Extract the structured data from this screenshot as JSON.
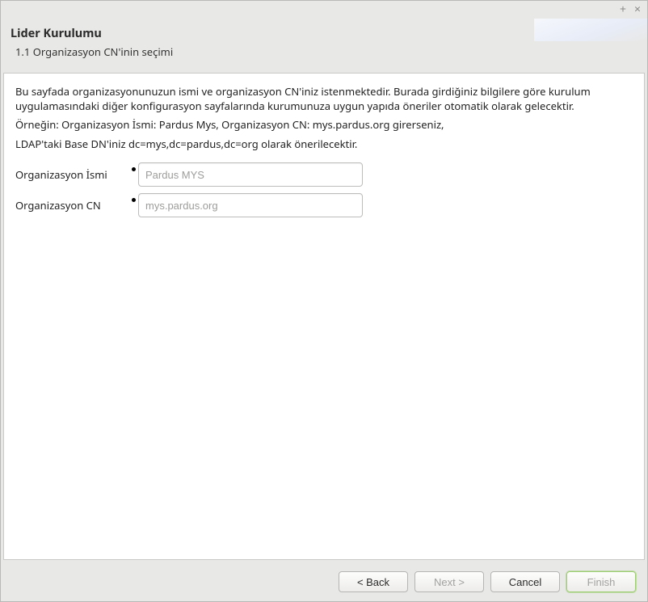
{
  "titlebar": {
    "add_icon": "+",
    "close_icon": "×"
  },
  "header": {
    "title": "Lider Kurulumu",
    "subtitle": "1.1 Organizasyon CN'inin seçimi"
  },
  "content": {
    "para1": "Bu sayfada organizasyonunuzun ismi ve organizasyon CN'iniz istenmektedir. Burada girdiğiniz bilgilere göre kurulum uygulamasındaki diğer konfigurasyon sayfalarında kurumunuza uygun yapıda öneriler otomatik olarak gelecektir.",
    "para2": "Örneğin: Organizasyon İsmi: Pardus Mys, Organizasyon CN: mys.pardus.org girerseniz,",
    "para3": "LDAP'taki Base DN'iniz dc=mys,dc=pardus,dc=org olarak önerilecektir."
  },
  "form": {
    "org_name_label": "Organizasyon İsmi",
    "org_name_placeholder": "Pardus MYS",
    "org_name_value": "",
    "org_cn_label": "Organizasyon CN",
    "org_cn_placeholder": "mys.pardus.org",
    "org_cn_value": ""
  },
  "footer": {
    "back": "< Back",
    "next": "Next >",
    "cancel": "Cancel",
    "finish": "Finish"
  }
}
